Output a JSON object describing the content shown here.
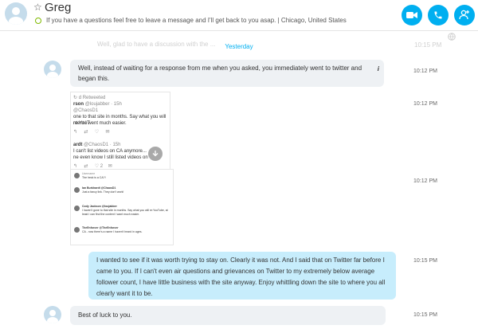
{
  "header": {
    "contact_name": "Greg",
    "mood_message": "If you have a questions feel free to leave a message and I'll get back to you asap.",
    "separator": "|",
    "location": "Chicago, United States",
    "accent_color": "#00aff0",
    "status_color": "#7fba00"
  },
  "conversation": {
    "faded_message": "Well, glad to have a discussion with the ...",
    "faded_time": "10:15 PM",
    "day_separator": "Yesterday",
    "messages": [
      {
        "text": "Well, instead of waiting for a response from me when you asked, you immediately went to twitter and began this.",
        "time": "10:12 PM"
      },
      {
        "time": "10:12 PM"
      },
      {
        "time": "10:12 PM"
      },
      {
        "text": "I wanted to see if it was worth trying to stay on. Clearly it was not. And I said that on Twitter far before I came to you. If I can't even air questions and grievances on Twitter to my extremely below average follower count, I have little business with the site anyway. Enjoy whittling down the site to where you all clearly want it to be.",
        "time": "10:15 PM"
      },
      {
        "text": "Best of luck to you.",
        "time": "10:15 PM"
      }
    ]
  },
  "screenshot1": {
    "retweeted": "d Retweeted",
    "tweet1_name": "rson",
    "tweet1_handle": "@loujabber · 15h",
    "tweet1_reply": "@ChaosD1",
    "tweet1_line1": "one to that site in months. Say what you will re:YouT",
    "tweet1_line2": "ntent I went much easier.",
    "tweet2_name": "ardt",
    "tweet2_handle": "@ChaosD1 · 15h",
    "tweet2_line1": "I can't list videos on CA anymore...",
    "tweet2_line2": "ne even know I still listed videos on CA?",
    "tweet2_count": "2"
  },
  "screenshot2": {
    "rows": [
      {
        "name": "Username",
        "text": "The heck is a CA?!"
      },
      {
        "name": "Ian Burkhardt @ChaosD1",
        "text": "Just a fancy link. They don't work!"
      },
      {
        "name": "Cody Jackson @loujabber",
        "text": "I haven't gone to that site in months. Say what you will re:YouTube, at least I can find the content I want much easier."
      },
      {
        "name": "TheEnforcer @TheEnforcer",
        "text": "CA - now there's a name I haven't heard in ages."
      }
    ]
  }
}
